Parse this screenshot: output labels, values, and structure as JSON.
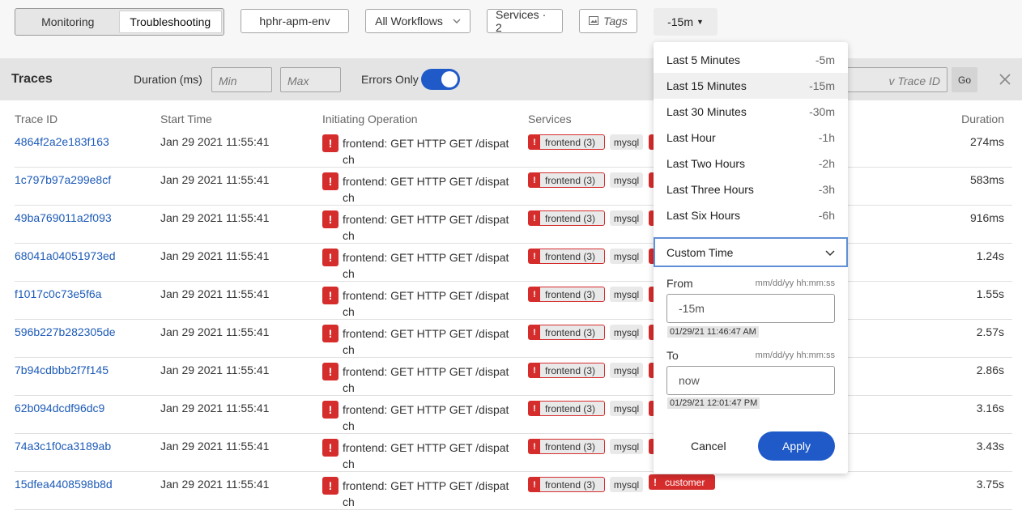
{
  "topbar": {
    "tabs": [
      {
        "label": "Monitoring",
        "active": false
      },
      {
        "label": "Troubleshooting",
        "active": true
      }
    ],
    "environment": "hphr-apm-env",
    "workflow": "All Workflows",
    "services": "Services · 2",
    "tags": "Tags",
    "time_range": "-15m"
  },
  "filters": {
    "title": "Traces",
    "duration_label": "Duration (ms)",
    "min_placeholder": "Min",
    "max_placeholder": "Max",
    "errors_only_label": "Errors Only",
    "errors_only_on": true,
    "trace_id_placeholder": "v Trace ID",
    "go_label": "Go"
  },
  "table": {
    "headers": {
      "trace_id": "Trace ID",
      "start_time": "Start Time",
      "initiating_operation": "Initiating Operation",
      "services": "Services",
      "duration": "Duration"
    },
    "rows": [
      {
        "trace_id": "4864f2a2e183f163",
        "start_time": "Jan 29 2021 11:55:41",
        "operation": "frontend: GET HTTP GET /dispatch",
        "svc_frontend": "frontend (3)",
        "svc_mysql": "mysql",
        "duration": "274ms"
      },
      {
        "trace_id": "1c797b97a299e8cf",
        "start_time": "Jan 29 2021 11:55:41",
        "operation": "frontend: GET HTTP GET /dispatch",
        "svc_frontend": "frontend (3)",
        "svc_mysql": "mysql",
        "duration": "583ms"
      },
      {
        "trace_id": "49ba769011a2f093",
        "start_time": "Jan 29 2021 11:55:41",
        "operation": "frontend: GET HTTP GET /dispatch",
        "svc_frontend": "frontend (3)",
        "svc_mysql": "mysql",
        "duration": "916ms"
      },
      {
        "trace_id": "68041a04051973ed",
        "start_time": "Jan 29 2021 11:55:41",
        "operation": "frontend: GET HTTP GET /dispatch",
        "svc_frontend": "frontend (3)",
        "svc_mysql": "mysql",
        "duration": "1.24s"
      },
      {
        "trace_id": "f1017c0c73e5f6a",
        "start_time": "Jan 29 2021 11:55:41",
        "operation": "frontend: GET HTTP GET /dispatch",
        "svc_frontend": "frontend (3)",
        "svc_mysql": "mysql",
        "duration": "1.55s"
      },
      {
        "trace_id": "596b227b282305de",
        "start_time": "Jan 29 2021 11:55:41",
        "operation": "frontend: GET HTTP GET /dispatch",
        "svc_frontend": "frontend (3)",
        "svc_mysql": "mysql",
        "duration": "2.57s"
      },
      {
        "trace_id": "7b94cdbbb2f7f145",
        "start_time": "Jan 29 2021 11:55:41",
        "operation": "frontend: GET HTTP GET /dispatch",
        "svc_frontend": "frontend (3)",
        "svc_mysql": "mysql",
        "duration": "2.86s"
      },
      {
        "trace_id": "62b094dcdf96dc9",
        "start_time": "Jan 29 2021 11:55:41",
        "operation": "frontend: GET HTTP GET /dispatch",
        "svc_frontend": "frontend (3)",
        "svc_mysql": "mysql",
        "duration": "3.16s"
      },
      {
        "trace_id": "74a3c1f0ca3189ab",
        "start_time": "Jan 29 2021 11:55:41",
        "operation": "frontend: GET HTTP GET /dispatch",
        "svc_frontend": "frontend (3)",
        "svc_mysql": "mysql",
        "duration": "3.43s"
      },
      {
        "trace_id": "15dfea4408598b8d",
        "start_time": "Jan 29 2021 11:55:41",
        "operation": "frontend: GET HTTP GET /dispatch",
        "svc_frontend": "frontend (3)",
        "svc_mysql": "mysql",
        "duration": "3.75s"
      }
    ],
    "last_row_customer": "customer"
  },
  "time_dropdown": {
    "options": [
      {
        "label": "Last 5 Minutes",
        "short": "-5m",
        "selected": false
      },
      {
        "label": "Last 15 Minutes",
        "short": "-15m",
        "selected": true
      },
      {
        "label": "Last 30 Minutes",
        "short": "-30m",
        "selected": false
      },
      {
        "label": "Last Hour",
        "short": "-1h",
        "selected": false
      },
      {
        "label": "Last Two Hours",
        "short": "-2h",
        "selected": false
      },
      {
        "label": "Last Three Hours",
        "short": "-3h",
        "selected": false
      },
      {
        "label": "Last Six Hours",
        "short": "-6h",
        "selected": false
      }
    ],
    "custom_label": "Custom Time",
    "from_label": "From",
    "from_format": "mm/dd/yy hh:mm:ss",
    "from_value": "-15m",
    "from_resolved": "01/29/21 11:46:47 AM",
    "to_label": "To",
    "to_format": "mm/dd/yy hh:mm:ss",
    "to_value": "now",
    "to_resolved": "01/29/21 12:01:47 PM",
    "cancel_label": "Cancel",
    "apply_label": "Apply"
  },
  "colors": {
    "accent": "#1f5ac8",
    "error": "#d52c2c",
    "link": "#1d5bb8"
  }
}
